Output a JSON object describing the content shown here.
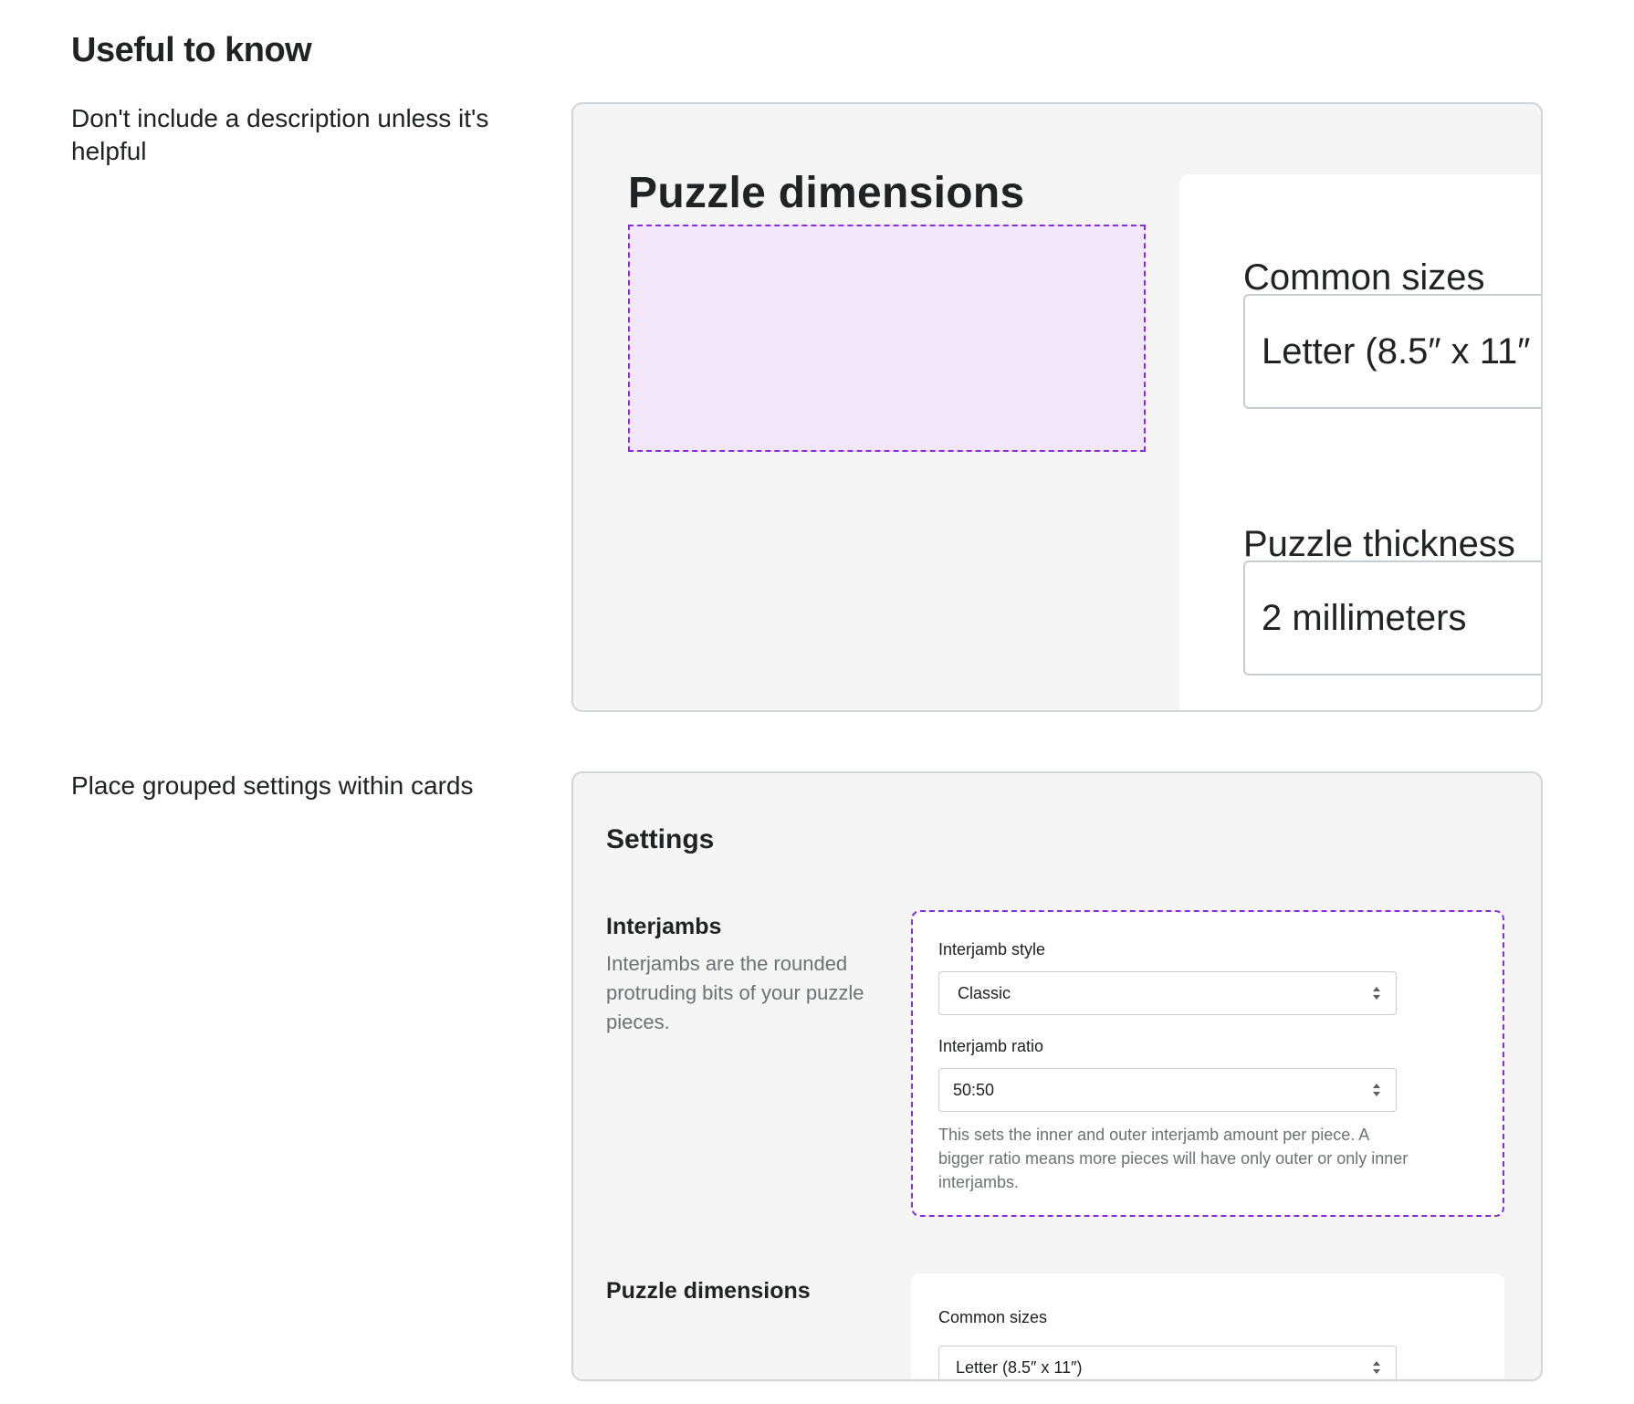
{
  "page": {
    "title": "Useful to know"
  },
  "guidelines": [
    {
      "note": "Don't include a description unless it's helpful"
    },
    {
      "note": "Place grouped settings within cards"
    }
  ],
  "example1": {
    "title": "Puzzle dimensions",
    "common_sizes_label": "Common sizes",
    "common_sizes_value": "Letter (8.5″ x 11″",
    "thickness_label": "Puzzle thickness",
    "thickness_value": "2 millimeters"
  },
  "example2": {
    "title": "Settings",
    "sections": [
      {
        "title": "Interjambs",
        "description": "Interjambs are the rounded protruding bits of your puzzle pieces.",
        "fields": [
          {
            "label": "Interjamb style",
            "value": "Classic"
          },
          {
            "label": "Interjamb ratio",
            "value": "50:50",
            "help": "This sets the inner and outer interjamb amount per piece. A bigger ratio means more pieces will have only outer or only inner interjambs."
          }
        ]
      },
      {
        "title": "Puzzle dimensions",
        "fields": [
          {
            "label": "Common sizes",
            "value": "Letter (8.5″ x 11″)"
          }
        ]
      }
    ]
  },
  "colors": {
    "accent": "#8a2be2",
    "placeholder_fill": "#f2e6fa",
    "panel_bg": "#f5f5f5",
    "subdued_text": "#6d7175"
  }
}
